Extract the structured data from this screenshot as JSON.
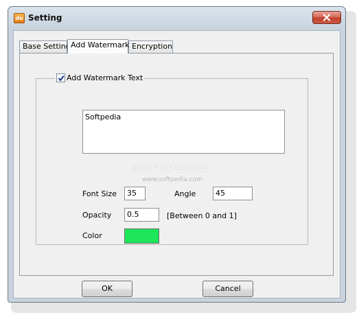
{
  "window": {
    "title": "Setting",
    "app_icon_text": "du",
    "icon": "close-icon"
  },
  "tabs": [
    {
      "label": "Base Setting",
      "active": false
    },
    {
      "label": "Add Watermark",
      "active": true
    },
    {
      "label": "Encryption",
      "active": false
    }
  ],
  "watermark_group": {
    "checkbox_label": "Add Watermark Text",
    "checked": true,
    "text_value": "Softpedia",
    "font_size_label": "Font Size",
    "font_size_value": "35",
    "angle_label": "Angle",
    "angle_value": "45",
    "opacity_label": "Opacity",
    "opacity_value": "0.5",
    "opacity_hint": "[Between 0 and 1]",
    "color_label": "Color",
    "color_value": "#1ee65a"
  },
  "overlay": {
    "watermark_text": "SOFTPEDIA",
    "watermark_url": "www.softpedia.com"
  },
  "buttons": {
    "ok": "OK",
    "cancel": "Cancel"
  }
}
